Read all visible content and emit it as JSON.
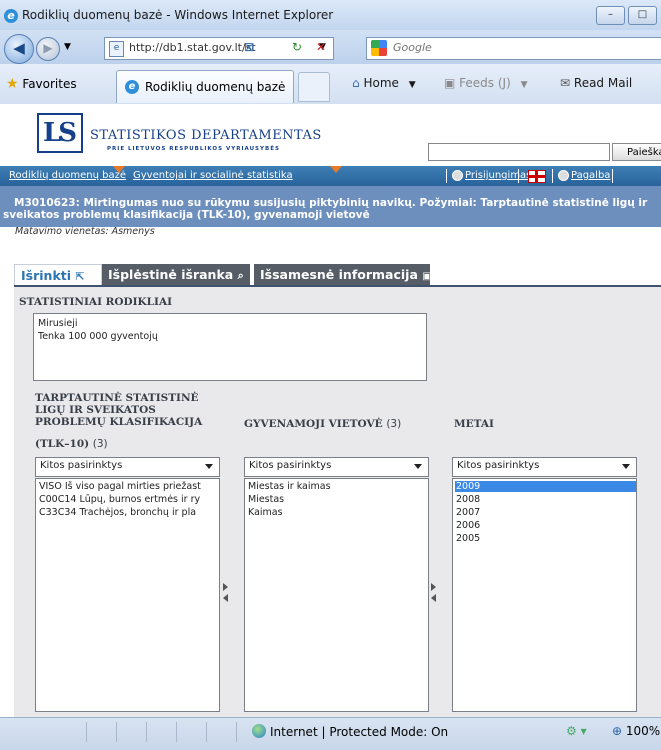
{
  "window": {
    "title": "Rodiklių duomenų bazė - Windows Internet Explorer",
    "minimize": "–",
    "maximize": "□"
  },
  "address": {
    "url": "http://db1.stat.gov.lt/st",
    "search_placeholder": "Google"
  },
  "favorites_bar": {
    "favorites_label": "Favorites",
    "tab_title": "Rodiklių duomenų bazė",
    "home": "Home",
    "feeds": "Feeds (J)",
    "read_mail": "Read Mail"
  },
  "site": {
    "org_name": "STATISTIKOS DEPARTAMENTAS",
    "org_sub": "PRIE LIETUVOS RESPUBLIKOS VYRIAUSYBĖS",
    "search_button": "Paieška",
    "nav": {
      "database": "Rodiklių duomenų bazė",
      "population": "Gyventojai ir socialinė statistika",
      "login": "Prisijungimas",
      "help": "Pagalba"
    },
    "table_title_line1": "M3010623: Mirtingumas nuo su rūkymu susijusių piktybinių navikų. Požymiai: Tarptautinė statistinė ligų ir",
    "table_title_line2": "sveikatos problemų klasifikacija (TLK-10), gyvenamoji vietovė",
    "unit": "Matavimo vienetas: Asmenys"
  },
  "tabs": {
    "select": "Išrinkti",
    "extended": "Išplėstinė išranka",
    "more_info": "Išsamesnė informacija"
  },
  "indicators": {
    "header": "STATISTINIAI RODIKLIAI",
    "items": [
      "Mirusieji",
      "Tenka 100 000 gyventojų"
    ]
  },
  "dimensions": {
    "tlk": {
      "header_lines": [
        "TARPTAUTINĖ STATISTINĖ",
        "LIGŲ IR SVEIKATOS",
        "PROBLEMŲ KLASIFIKACIJA",
        "(TLK–10)"
      ],
      "count": "(3)",
      "dropdown": "Kitos pasirinktys",
      "items": [
        "VISO Iš viso pagal mirties priežast",
        "C00C14 Lūpų, burnos ertmės ir ry",
        "C33C34 Trachėjos, bronchų ir pla"
      ]
    },
    "area": {
      "header": "GYVENAMOJI VIETOVĖ",
      "count": "(3)",
      "dropdown": "Kitos pasirinktys",
      "items": [
        "Miestas ir kaimas",
        "Miestas",
        "Kaimas"
      ]
    },
    "years": {
      "header": "METAI",
      "dropdown": "Kitos pasirinktys",
      "items": [
        "2009",
        "2008",
        "2007",
        "2006",
        "2005"
      ],
      "selected": "2009"
    }
  },
  "statusbar": {
    "zone": "Internet | Protected Mode: On",
    "zoom": "100%"
  }
}
